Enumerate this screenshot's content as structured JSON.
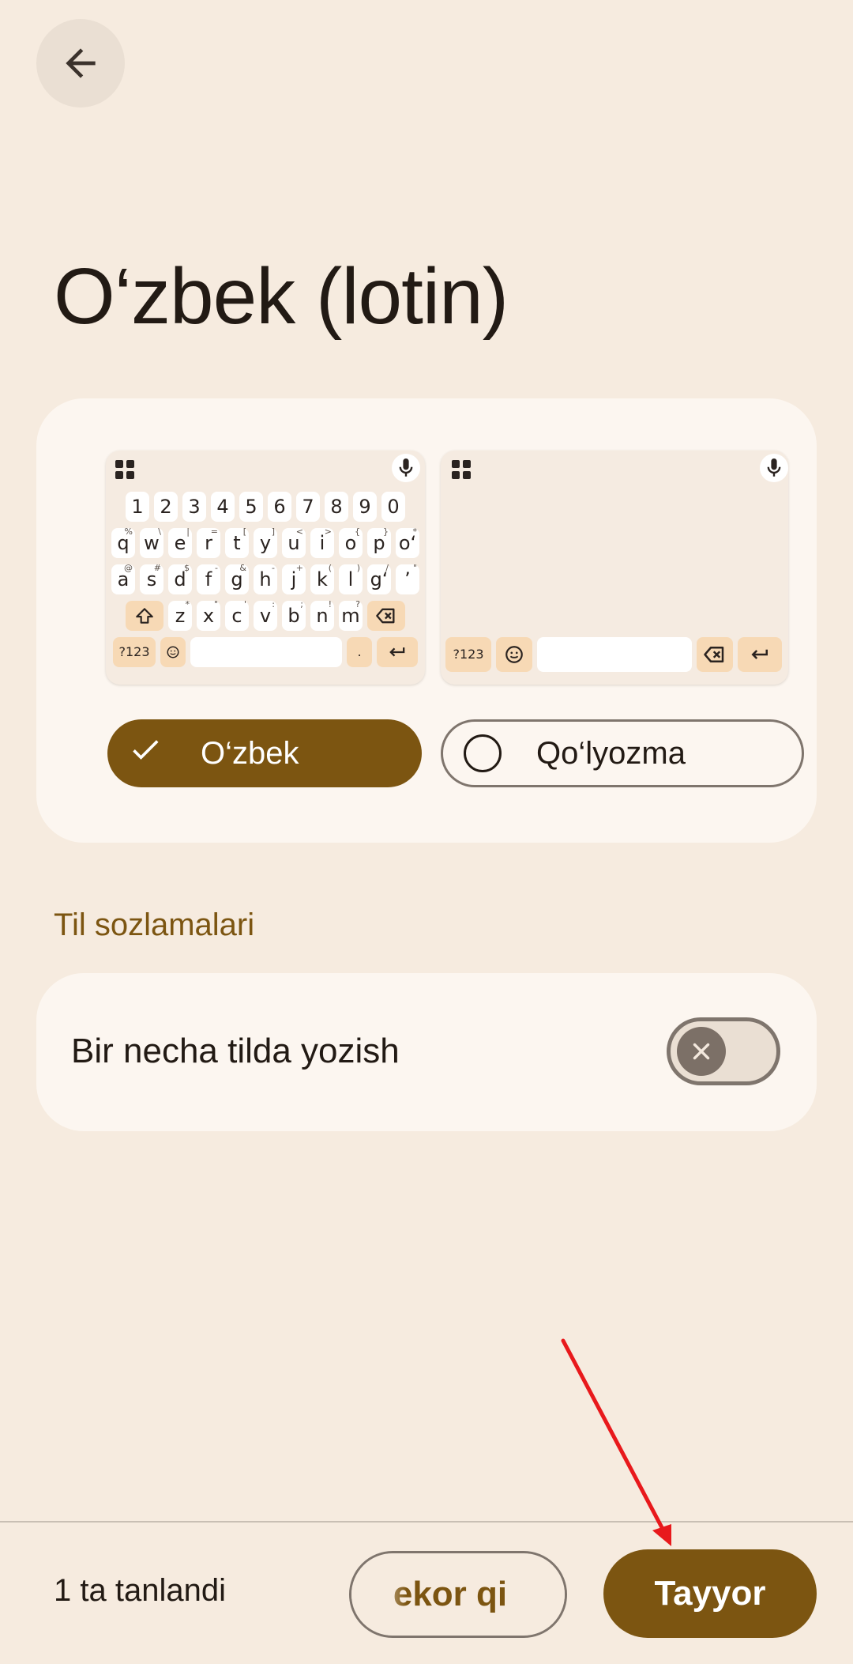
{
  "page": {
    "title": "O‘zbek (lotin)"
  },
  "keyboard_preview": {
    "number_row": [
      "1",
      "2",
      "3",
      "4",
      "5",
      "6",
      "7",
      "8",
      "9",
      "0"
    ],
    "row1": [
      {
        "k": "q",
        "s": "%"
      },
      {
        "k": "w",
        "s": "\\"
      },
      {
        "k": "e",
        "s": "|"
      },
      {
        "k": "r",
        "s": "="
      },
      {
        "k": "t",
        "s": "["
      },
      {
        "k": "y",
        "s": "]"
      },
      {
        "k": "u",
        "s": "<"
      },
      {
        "k": "i",
        "s": ">"
      },
      {
        "k": "o",
        "s": "{"
      },
      {
        "k": "p",
        "s": "}"
      },
      {
        "k": "o‘",
        "s": "*"
      }
    ],
    "row2": [
      {
        "k": "a",
        "s": "@"
      },
      {
        "k": "s",
        "s": "#"
      },
      {
        "k": "d",
        "s": "$"
      },
      {
        "k": "f",
        "s": "-"
      },
      {
        "k": "g",
        "s": "&"
      },
      {
        "k": "h",
        "s": "-"
      },
      {
        "k": "j",
        "s": "+"
      },
      {
        "k": "k",
        "s": "("
      },
      {
        "k": "l",
        "s": ")"
      },
      {
        "k": "g‘",
        "s": "/"
      },
      {
        "k": "’",
        "s": "\""
      }
    ],
    "row3": [
      {
        "k": "z",
        "s": "*"
      },
      {
        "k": "x",
        "s": "\""
      },
      {
        "k": "c",
        "s": "'"
      },
      {
        "k": "v",
        "s": ":"
      },
      {
        "k": "b",
        "s": ";"
      },
      {
        "k": "n",
        "s": "!"
      },
      {
        "k": "m",
        "s": "?"
      }
    ],
    "symbols_key": "?123",
    "period_key": "."
  },
  "layout_options": [
    {
      "label": "O‘zbek",
      "selected": true
    },
    {
      "label": "Qo‘lyozma",
      "selected": false
    }
  ],
  "language_settings": {
    "section_title": "Til sozlamalari",
    "multilingual_label": "Bir necha tilda yozish",
    "multilingual_enabled": false
  },
  "footer": {
    "selected_count": "1 ta tanlandi",
    "skip_label": "ekor qi",
    "done_label": "Tayyor"
  },
  "colors": {
    "background": "#f6ebdf",
    "card": "#fcf6f0",
    "accent": "#7c5511",
    "annotation": "#e8191c"
  },
  "icons": {
    "back": "arrow-left-icon",
    "selected_chip": "check-icon",
    "unselected_chip": "radio-icon",
    "toggle": "close-icon"
  }
}
